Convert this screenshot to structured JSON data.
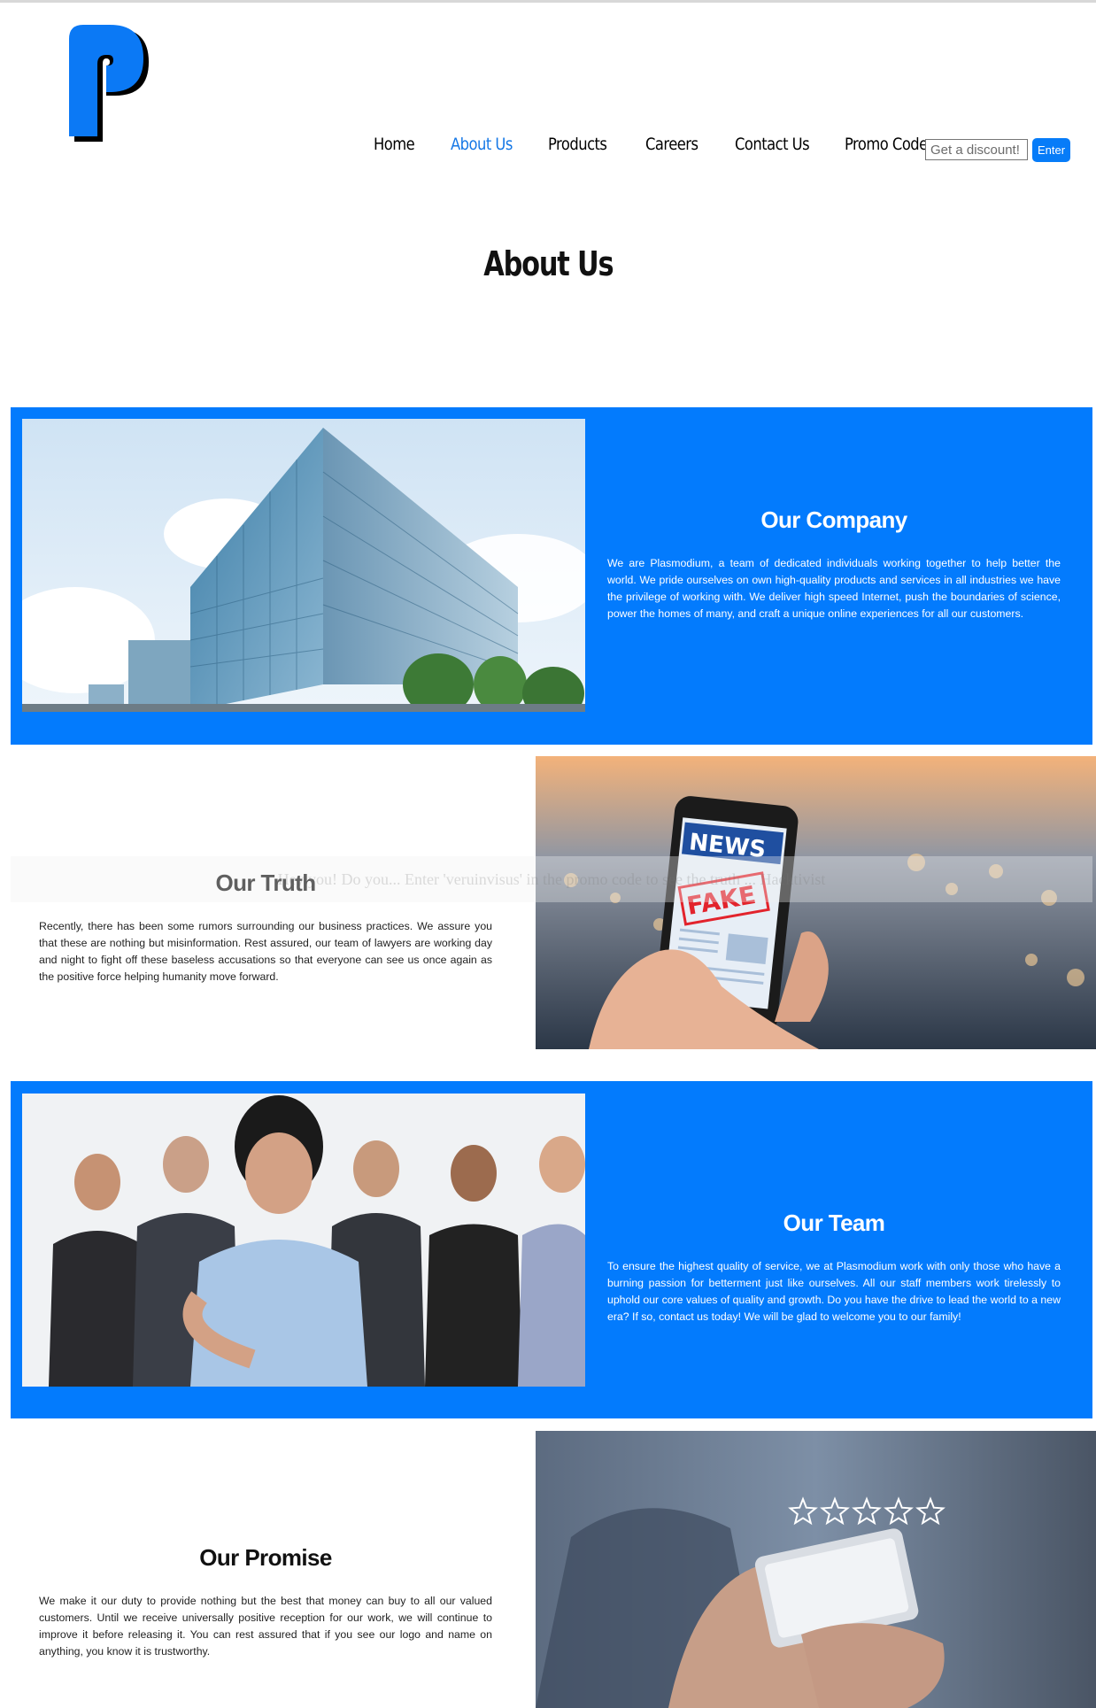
{
  "brand": {
    "logo_letter": "P",
    "logo_color": "#0b79f5"
  },
  "nav": {
    "items": [
      {
        "label": "Home",
        "active": false
      },
      {
        "label": "About Us",
        "active": true
      },
      {
        "label": "Products",
        "active": false
      },
      {
        "label": "Careers",
        "active": false
      },
      {
        "label": "Contact Us",
        "active": false
      },
      {
        "label": "Promo Code",
        "active": false
      }
    ],
    "promo_placeholder": "Get a discount!",
    "promo_button": "Enter"
  },
  "page_title": "About Us",
  "hidden_message": "Hey you! Do you... Enter 'veruinvisus' in the promo code to see the truth ... Hacktivist",
  "sections": [
    {
      "title": "Our Company",
      "text": "We are Plasmodium, a team of dedicated individuals working together to help better the world. We pride ourselves on own high-quality products and services in all industries we have the privilege of working with. We deliver high speed Internet, push the boundaries of science, power the homes of many, and craft a unique online experiences for all our customers.",
      "image": "office-building-image"
    },
    {
      "title": "Our Truth",
      "text": "Recently, there has been some rumors surrounding our business practices. We assure you that these are nothing but misinformation. Rest assured, our team of lawyers are working day and night to fight off these baseless accusations so that everyone can see us once again as the positive force helping humanity move forward.",
      "image": "fake-news-phone-image",
      "image_text_news": "NEWS",
      "image_text_fake": "FAKE"
    },
    {
      "title": "Our Team",
      "text": "To ensure the highest quality of service, we at Plasmodium work with only those who have a burning passion for betterment just like ourselves. All our staff members work tirelessly to uphold our core values of quality and growth. Do you have the drive to lead the world to a new era? If so, contact us today! We will be glad to welcome you to our family!",
      "image": "team-photo-image"
    },
    {
      "title": "Our Promise",
      "text": "We make it our duty to provide nothing but the best that money can buy to all our valued customers. Until we receive universally positive reception for our work, we will continue to improve it before releasing it. You can rest assured that if you see our logo and name on anything, you know it is trustworthy.",
      "image": "rating-stars-phone-image",
      "stars": 5
    }
  ],
  "colors": {
    "accent": "#037bfd",
    "nav_active": "#1477e6"
  }
}
